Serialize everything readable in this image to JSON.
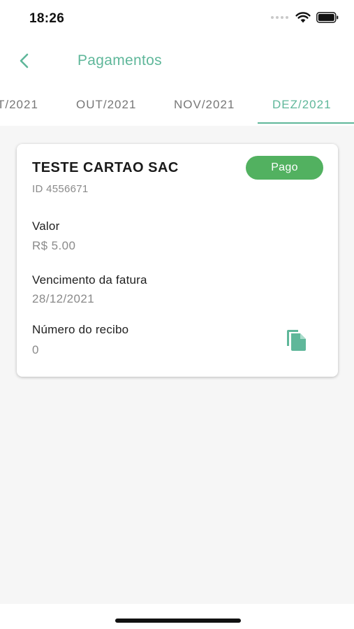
{
  "status_bar": {
    "time": "18:26"
  },
  "header": {
    "title": "Pagamentos",
    "back_icon": "chevron-left-icon"
  },
  "tabs": [
    {
      "label": "T/2021"
    },
    {
      "label": "OUT/2021"
    },
    {
      "label": "NOV/2021"
    },
    {
      "label": "DEZ/2021",
      "selected": true
    }
  ],
  "card": {
    "title": "TESTE CARTAO SAC",
    "id_text": "ID 4556671",
    "status": "Pago",
    "fields": [
      {
        "label": "Valor",
        "value": "R$ 5.00"
      },
      {
        "label": "Vencimento da fatura",
        "value": "28/12/2021"
      },
      {
        "label": "Número do recibo",
        "value": "0"
      }
    ],
    "copy_icon": "copy-icon"
  },
  "colors": {
    "accent": "#5fb79a",
    "status_paid": "#52b160",
    "background": "#f6f6f6"
  }
}
